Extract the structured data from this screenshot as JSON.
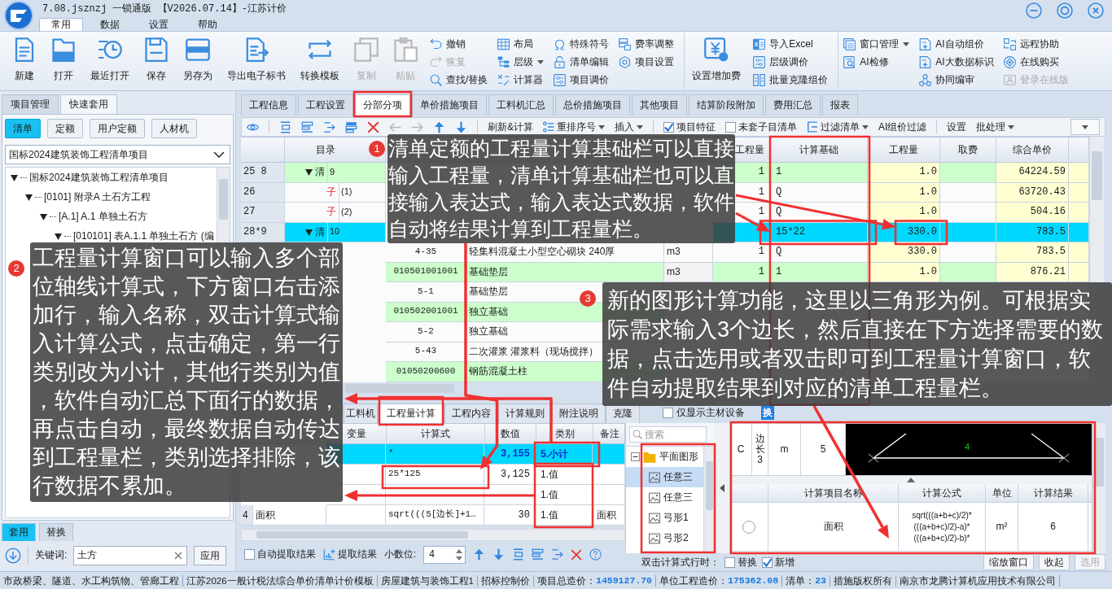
{
  "window": {
    "title": "7.08.jsznzj 一锁通版 【V2026.07.14】-江苏计价"
  },
  "menu_tabs": [
    {
      "label": "常用",
      "selected": true
    },
    {
      "label": "数据",
      "selected": false
    },
    {
      "label": "设置",
      "selected": false
    },
    {
      "label": "帮助",
      "selected": false
    }
  ],
  "ribbon": [
    {
      "items": [
        {
          "kind": "large",
          "label": "新建",
          "disabled": false
        },
        {
          "kind": "large",
          "label": "打开",
          "disabled": false
        },
        {
          "kind": "large",
          "label": "最近打开",
          "disabled": false
        },
        {
          "kind": "large",
          "label": "保存",
          "disabled": false
        },
        {
          "kind": "large",
          "label": "另存为",
          "disabled": false
        },
        {
          "kind": "large",
          "label": "导出电子标书",
          "disabled": false
        },
        {
          "kind": "large",
          "label": "转换模板",
          "disabled": false
        },
        {
          "kind": "large",
          "label": "复制",
          "disabled": true
        },
        {
          "kind": "large",
          "label": "粘贴",
          "disabled": true
        },
        {
          "kind": "stack",
          "buttons": [
            {
              "label": "撤销",
              "disabled": false,
              "dropdown": false
            },
            {
              "label": "恢复",
              "disabled": true,
              "dropdown": false
            },
            {
              "label": "查找/替换",
              "disabled": false,
              "dropdown": false
            }
          ]
        },
        {
          "kind": "stack",
          "buttons": [
            {
              "label": "布局",
              "disabled": false,
              "dropdown": false
            },
            {
              "label": "层级",
              "disabled": false,
              "dropdown": true
            },
            {
              "label": "计算器",
              "disabled": false,
              "dropdown": false
            }
          ]
        },
        {
          "kind": "stack",
          "buttons": [
            {
              "label": "特殊符号",
              "disabled": false,
              "dropdown": false
            },
            {
              "label": "清单编辑",
              "disabled": false,
              "dropdown": false
            },
            {
              "label": "项目调价",
              "disabled": false,
              "dropdown": false
            }
          ]
        },
        {
          "kind": "stack",
          "buttons": [
            {
              "label": "费率调整",
              "disabled": false,
              "dropdown": false
            },
            {
              "label": "项目设置",
              "disabled": false,
              "dropdown": false
            }
          ]
        }
      ]
    },
    {
      "items": [
        {
          "kind": "large",
          "label": "设置增加费",
          "disabled": false
        },
        {
          "kind": "stack",
          "buttons": [
            {
              "label": "导入Excel",
              "disabled": false,
              "dropdown": false
            },
            {
              "label": "层级调价",
              "disabled": false,
              "dropdown": false
            },
            {
              "label": "批量克隆组价",
              "disabled": false,
              "dropdown": false
            }
          ]
        }
      ]
    },
    {
      "items": [
        {
          "kind": "stack",
          "buttons": [
            {
              "label": "窗口管理",
              "disabled": false,
              "dropdown": true
            },
            {
              "label": "AI检修",
              "disabled": false,
              "dropdown": false
            }
          ]
        },
        {
          "kind": "stack",
          "buttons": [
            {
              "label": "AI自动组价",
              "disabled": false,
              "dropdown": false
            },
            {
              "label": "AI大数据标识",
              "disabled": false,
              "dropdown": false
            },
            {
              "label": "协同编审",
              "disabled": false,
              "dropdown": false
            }
          ]
        },
        {
          "kind": "stack",
          "buttons": [
            {
              "label": "远程协助",
              "disabled": false,
              "dropdown": false
            },
            {
              "label": "在线购买",
              "disabled": false,
              "dropdown": false
            },
            {
              "label": "登录在线版",
              "disabled": true,
              "dropdown": false
            }
          ]
        }
      ]
    }
  ],
  "left_panel": {
    "tabs": [
      {
        "label": "项目管理",
        "selected": false
      },
      {
        "label": "快速套用",
        "selected": true
      }
    ],
    "filters": [
      {
        "label": "清单",
        "selected": true
      },
      {
        "label": "定额",
        "selected": false
      },
      {
        "label": "用户定额",
        "selected": false
      },
      {
        "label": "人材机",
        "selected": false
      }
    ],
    "library": {
      "value": "国标2024建筑装饰工程清单项目"
    },
    "tree": [
      {
        "label": "国标2024建筑装饰工程清单项目",
        "expanded": true,
        "children": [
          {
            "label": "[0101] 附录A 土石方工程",
            "expanded": true,
            "children": [
              {
                "label": "[A.1] A.1 单独土石方",
                "expanded": true,
                "children": [
                  {
                    "label": "[010101] 表A.1.1 单独土石方 (编",
                    "expanded": true
                  }
                ]
              }
            ]
          }
        ]
      }
    ],
    "bottom_tabs": [
      {
        "label": "套用",
        "selected": true
      },
      {
        "label": "替换",
        "selected": false
      }
    ],
    "keyword": {
      "label": "关键词:",
      "value": "土方"
    },
    "apply_button": "应用"
  },
  "main_tabs": [
    {
      "label": "工程信息",
      "selected": false
    },
    {
      "label": "工程设置",
      "selected": false
    },
    {
      "label": "分部分项",
      "selected": true
    },
    {
      "label": "单价措施项目",
      "selected": false
    },
    {
      "label": "工料机汇总",
      "selected": false
    },
    {
      "label": "总价措施项目",
      "selected": false
    },
    {
      "label": "其他项目",
      "selected": false
    },
    {
      "label": "结算阶段附加",
      "selected": false
    },
    {
      "label": "费用汇总",
      "selected": false
    },
    {
      "label": "报表",
      "selected": false
    }
  ],
  "toolbar": [
    {
      "kind": "icon",
      "disabled": false
    },
    {
      "kind": "icon",
      "disabled": false
    },
    {
      "kind": "icon",
      "disabled": false
    },
    {
      "kind": "icon",
      "disabled": false
    },
    {
      "kind": "icon",
      "disabled": false
    },
    {
      "kind": "icon",
      "disabled": false
    },
    {
      "kind": "icon",
      "disabled": true
    },
    {
      "kind": "icon",
      "disabled": true
    },
    {
      "kind": "icon",
      "disabled": false
    },
    {
      "kind": "icon",
      "disabled": false
    },
    {
      "kind": "text",
      "label": "刷新&计算",
      "dropdown": false
    },
    {
      "kind": "text",
      "label": "重排序号",
      "dropdown": true
    },
    {
      "kind": "text",
      "label": "插入",
      "dropdown": true
    },
    {
      "kind": "check",
      "label": "项目特征",
      "checked": true
    },
    {
      "kind": "check",
      "label": "未套子目清单",
      "checked": false
    },
    {
      "kind": "text",
      "label": "过滤清单",
      "dropdown": true
    },
    {
      "kind": "text",
      "label": "AI组价过滤",
      "dropdown": false
    },
    {
      "kind": "text",
      "label": "设置",
      "dropdown": false
    },
    {
      "kind": "text",
      "label": "批处理",
      "dropdown": true
    },
    {
      "kind": "more"
    }
  ],
  "table": {
    "header": {
      "catalog": "目录",
      "column_6": "工程量",
      "basis": "计算基础",
      "quantity": "工程量",
      "fee": "取费",
      "unit_price": "综合单价"
    },
    "rows": [
      {
        "kind": "list",
        "selected": false,
        "expanded": true,
        "no": "25 8",
        "type": "清",
        "index": "9",
        "column_6": "1",
        "basis": "1",
        "quantity": "1.0",
        "unit_price": "64224.59"
      },
      {
        "kind": "item",
        "selected": false,
        "no": "26",
        "type": "子",
        "index": "(1)",
        "column_6": "1",
        "basis": "Q",
        "quantity": "1.0",
        "unit_price": "63720.43"
      },
      {
        "kind": "item",
        "selected": false,
        "no": "27",
        "type": "子",
        "index": "(2)",
        "column_6": "1",
        "basis": "Q",
        "quantity": "1.0",
        "unit_price": "504.16"
      },
      {
        "kind": "list",
        "selected": true,
        "expanded": true,
        "no": "28*9",
        "type": "清",
        "index": "10",
        "basis": "15*22",
        "quantity": "330.0",
        "unit_price": "783.5"
      },
      {
        "kind": "item",
        "selected": false,
        "code": "4-35",
        "name": "轻集料混凝土小型空心砌块 240厚",
        "unit": "m3",
        "column_6": "1",
        "basis": "Q",
        "quantity": "330.0",
        "unit_price": "783.5"
      },
      {
        "kind": "list",
        "selected": false,
        "code": "010501001001",
        "name": "基础垫层",
        "unit": "m3",
        "column_6": "1",
        "basis": "1",
        "quantity": "1.0",
        "unit_price": "876.21"
      },
      {
        "kind": "item",
        "selected": false,
        "code": "5-1",
        "name": "基础垫层"
      },
      {
        "kind": "list",
        "selected": false,
        "code": "010502001001",
        "name": "独立基础"
      },
      {
        "kind": "item",
        "selected": false,
        "code": "5-2",
        "name": "独立基础"
      },
      {
        "kind": "item",
        "selected": false,
        "code": "5-43",
        "name": "二次灌浆 灌浆料（现场搅拌）"
      },
      {
        "kind": "list",
        "selected": false,
        "code": "01050200600",
        "name": "钢筋混凝土柱"
      }
    ]
  },
  "bottom_tabs": [
    {
      "label": "工料机",
      "selected": false
    },
    {
      "label": "工程量计算",
      "selected": true
    },
    {
      "label": "工程内容",
      "selected": false
    },
    {
      "label": "计算规则",
      "selected": false
    },
    {
      "label": "附注说明",
      "selected": false
    },
    {
      "label": "克隆",
      "selected": false
    }
  ],
  "main_materials_only": {
    "label": "仅显示主材设备",
    "checked": false
  },
  "swap_button": "换",
  "calc_grid": {
    "header": {
      "variable": "变量",
      "expression": "计算式",
      "value": "数值",
      "category": "类别",
      "note": "备注"
    },
    "rows": [
      {
        "kind": "subtotal",
        "selected": true,
        "expression": "*",
        "value": "3,155",
        "category": "5.小计"
      },
      {
        "kind": "value",
        "selected": false,
        "expression": "25*125",
        "value": "3,125",
        "category": "1.值"
      },
      {
        "kind": "value",
        "selected": false,
        "category": "1.值"
      },
      {
        "kind": "value",
        "selected": false,
        "no": "4",
        "name": "面积",
        "expression": "sqrt(((5[边长]+1…",
        "value": "30",
        "category": "1.值",
        "note": "面积"
      }
    ]
  },
  "calc_toolbar": {
    "auto_extract": {
      "label": "自动提取结果",
      "checked": false
    },
    "extract_button": "提取结果",
    "decimals": {
      "label": "小数位:",
      "value": "4"
    }
  },
  "shape_search": {
    "placeholder": "搜索"
  },
  "shape_tree": [
    {
      "label": "平面图形",
      "expanded": true,
      "children": [
        {
          "label": "任意三",
          "selected": true
        },
        {
          "label": "任意三",
          "selected": false
        },
        {
          "label": "弓形1",
          "selected": false
        },
        {
          "label": "弓形2",
          "selected": false
        }
      ]
    }
  ],
  "double_click": {
    "label": "双击计算式行时：",
    "options": [
      {
        "label": "替换",
        "checked": false
      },
      {
        "label": "新增",
        "checked": true
      }
    ]
  },
  "parameters": [
    {
      "symbol": "C",
      "name": "边长3",
      "unit": "m",
      "value": "5"
    }
  ],
  "diagram": {
    "label": "4"
  },
  "results": {
    "header": [
      "计算项目名称",
      "计算公式",
      "单位",
      "计算结果"
    ],
    "rows": [
      {
        "selected": false,
        "name": "面积",
        "formula": [
          "sqrt(((a+b+c)/2)*",
          "(((a+b+c)/2)-a)*",
          "(((a+b+c)/2)-b)*"
        ],
        "unit": "m²",
        "result": "6"
      }
    ]
  },
  "panel_buttons": [
    {
      "label": "缩放窗口",
      "disabled": false
    },
    {
      "label": "收起",
      "disabled": false
    },
    {
      "label": "选用",
      "disabled": true
    }
  ],
  "status_bar": [
    {
      "text": "市政桥梁、隧道、水工构筑物、管廊工程"
    },
    {
      "text": "江苏2026一般计税法综合单价清单计价模板"
    },
    {
      "text": "房屋建筑与装饰工程1"
    },
    {
      "text": "招标控制价"
    },
    {
      "label": "项目总造价：",
      "value": "1459127.70"
    },
    {
      "label": "单位工程造价：",
      "value": "175362.08"
    },
    {
      "label": "清单：",
      "value": "23"
    },
    {
      "text": "措施版权所有"
    },
    {
      "text": "南京市龙腾计算机应用技术有限公司"
    }
  ],
  "callouts": [
    {
      "number": "1",
      "text": "清单定额的工程量计算基础栏可以直接输入工程量，清单计算基础栏也可以直接输入表达式，输入表达式数据，软件自动将结果计算到工程量栏。"
    },
    {
      "number": "2",
      "text": "工程量计算窗口可以输入多个部位轴线计算式，下方窗口右击添加行，输入名称，双击计算式输入计算公式，点击确定，第一行类别改为小计，其他行类别为值，软件自动汇总下面行的数据，再点击自动，最终数据自动传达到工程量栏，类别选择排除，该行数据不累加。"
    },
    {
      "number": "3",
      "text": "新的图形计算功能，这里以三角形为例。可根据实际需求输入3个边长，然后直接在下方选择需要的数据，点击选用或者双击即可到工程量计算窗口，软件自动提取结果到对应的清单工程量栏。"
    }
  ]
}
